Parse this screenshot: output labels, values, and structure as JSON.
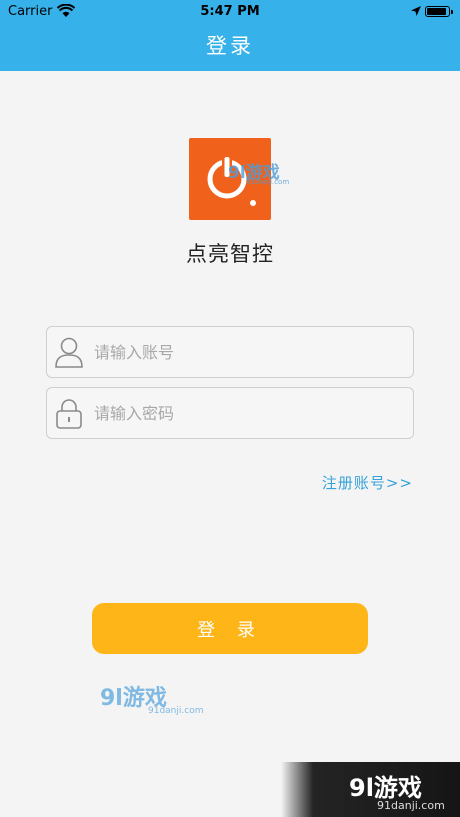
{
  "status_bar": {
    "carrier": "Carrier",
    "time": "5:47 PM",
    "battery_level": 0.9
  },
  "header": {
    "title": "登录"
  },
  "app": {
    "name": "点亮智控",
    "logo_color": "#f0621b"
  },
  "form": {
    "account_placeholder": "请输入账号",
    "password_placeholder": "请输入密码",
    "register_link": "注册账号>>",
    "login_button": "登 录"
  },
  "watermarks": {
    "logo_overlay": "9l游戏",
    "logo_overlay_sub": "91danji.com",
    "small": "9l游戏",
    "small_sub": "91danji.com",
    "corner": "9l游戏",
    "corner_sub": "91danji.com"
  },
  "colors": {
    "header": "#36b1ea",
    "accent_button": "#fdb518",
    "link": "#36a3d8"
  }
}
